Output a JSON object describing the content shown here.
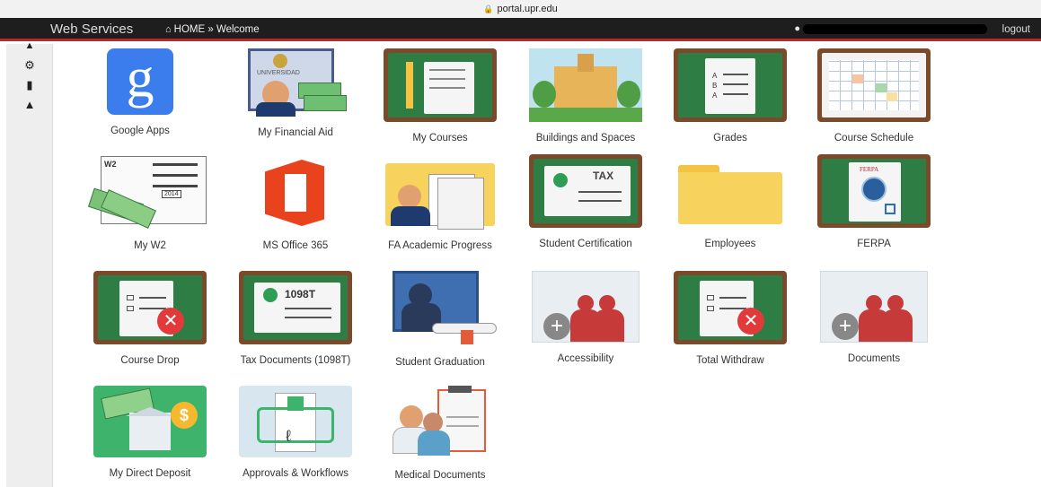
{
  "browser": {
    "url": "portal.upr.edu"
  },
  "header": {
    "brand": "Web Services",
    "breadcrumb": "HOME » Welcome",
    "logout": "logout"
  },
  "rail_icons": [
    "home-icon",
    "gear-icon",
    "bookmark-icon",
    "bell-icon"
  ],
  "apps": [
    {
      "label": "Google Apps",
      "icon": "google-icon"
    },
    {
      "label": "My Financial Aid",
      "icon": "financial-aid-icon"
    },
    {
      "label": "My Courses",
      "icon": "notebook-icon"
    },
    {
      "label": "Buildings and Spaces",
      "icon": "building-icon"
    },
    {
      "label": "Grades",
      "icon": "grades-icon"
    },
    {
      "label": "Course Schedule",
      "icon": "calendar-icon"
    },
    {
      "label": "My W2",
      "icon": "w2-form-icon"
    },
    {
      "label": "MS Office 365",
      "icon": "office-icon"
    },
    {
      "label": "FA Academic Progress",
      "icon": "academic-progress-icon"
    },
    {
      "label": "Student Certification",
      "icon": "tax-certificate-icon"
    },
    {
      "label": "Employees",
      "icon": "folder-icon"
    },
    {
      "label": "FERPA",
      "icon": "ferpa-document-icon"
    },
    {
      "label": "Course Drop",
      "icon": "course-drop-icon"
    },
    {
      "label": "Tax Documents (1098T)",
      "icon": "tax-document-icon"
    },
    {
      "label": "Student Graduation",
      "icon": "graduation-icon"
    },
    {
      "label": "Accessibility",
      "icon": "people-add-icon"
    },
    {
      "label": "Total Withdraw",
      "icon": "withdraw-icon"
    },
    {
      "label": "Documents",
      "icon": "people-add-icon"
    },
    {
      "label": "My Direct Deposit",
      "icon": "bank-deposit-icon"
    },
    {
      "label": "Approvals & Workflows",
      "icon": "approval-workflow-icon"
    },
    {
      "label": "Medical Documents",
      "icon": "medical-icon"
    }
  ],
  "icon_text": {
    "google": "g",
    "financial_aid": "UNIVERSIDAD",
    "w2": "W2",
    "w2_year": "2014",
    "tax": "TAX",
    "ferpa": "FERPA",
    "tax_1098": "1098T"
  },
  "colors": {
    "topbar": "#1e1e1e",
    "accent_red": "#b8282c",
    "board_frame": "#7a4a2a",
    "board_green": "#2e7d44",
    "google_blue": "#3b7ded",
    "office_orange": "#e8431c",
    "folder_yellow": "#f7d25c"
  }
}
